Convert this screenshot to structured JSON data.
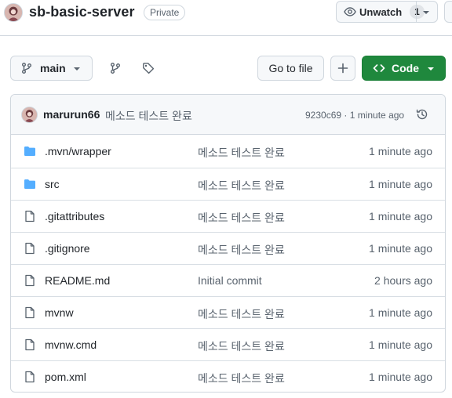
{
  "repo": {
    "name": "sb-basic-server",
    "visibility": "Private",
    "avatar_icon": "user-avatar"
  },
  "watch": {
    "label": "Unwatch",
    "count": "1",
    "icon": "eye-icon"
  },
  "toolbar": {
    "branch": "main",
    "goto_file": "Go to file",
    "add_icon": "plus-icon",
    "code_label": "Code",
    "branches_icon": "git-branch-icon",
    "tags_icon": "tag-icon"
  },
  "colors": {
    "accent_green": "#1f883d",
    "folder_blue": "#54aeff",
    "muted": "#59636e",
    "border": "#d0d7de"
  },
  "latest_commit": {
    "author": "marurun66",
    "message": "메소드 테스트 완료",
    "meta": "9230c69 · 1 minute ago",
    "history_icon": "history-icon"
  },
  "files": [
    {
      "name": ".mvn/wrapper",
      "type": "folder",
      "message": "메소드 테스트 완료",
      "time": "1 minute ago"
    },
    {
      "name": "src",
      "type": "folder",
      "message": "메소드 테스트 완료",
      "time": "1 minute ago"
    },
    {
      "name": ".gitattributes",
      "type": "file",
      "message": "메소드 테스트 완료",
      "time": "1 minute ago"
    },
    {
      "name": ".gitignore",
      "type": "file",
      "message": "메소드 테스트 완료",
      "time": "1 minute ago"
    },
    {
      "name": "README.md",
      "type": "file",
      "message": "Initial commit",
      "time": "2 hours ago"
    },
    {
      "name": "mvnw",
      "type": "file",
      "message": "메소드 테스트 완료",
      "time": "1 minute ago"
    },
    {
      "name": "mvnw.cmd",
      "type": "file",
      "message": "메소드 테스트 완료",
      "time": "1 minute ago"
    },
    {
      "name": "pom.xml",
      "type": "file",
      "message": "메소드 테스트 완료",
      "time": "1 minute ago"
    }
  ]
}
